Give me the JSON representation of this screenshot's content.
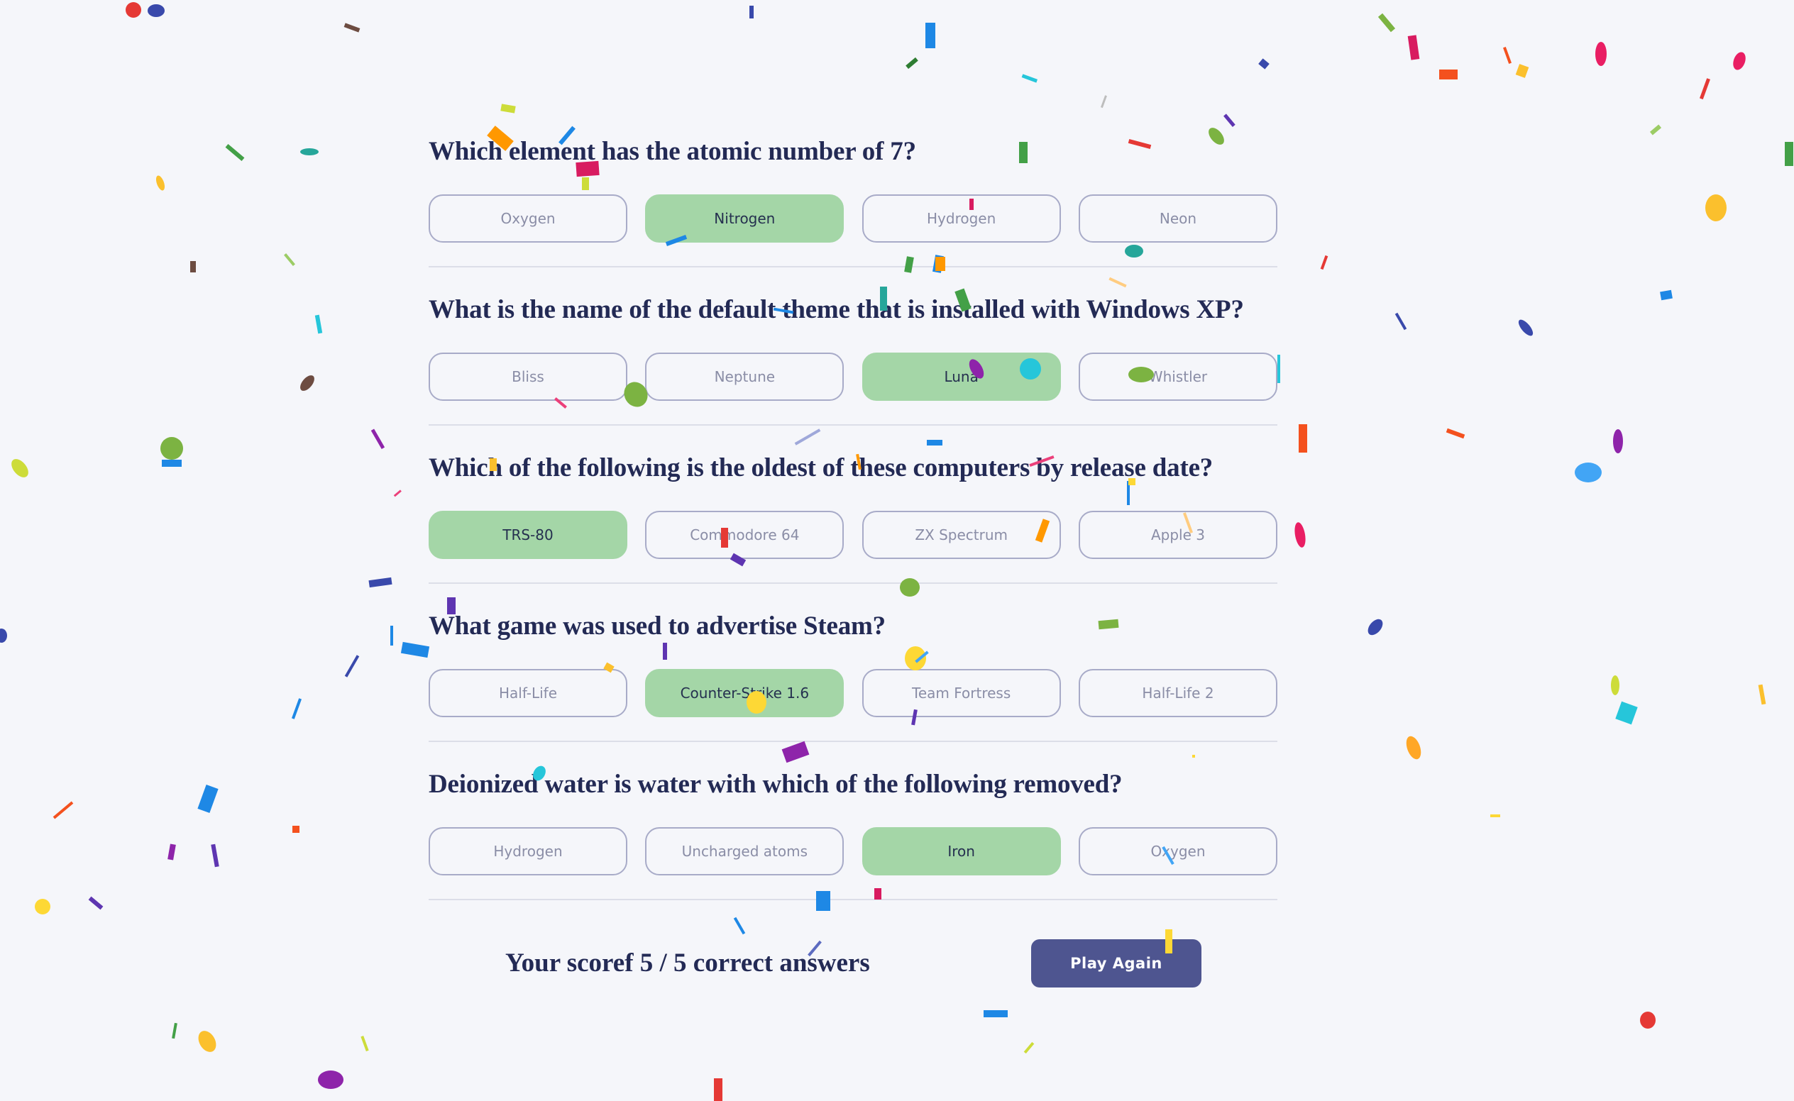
{
  "quiz": {
    "questions": [
      {
        "text": "Which element has the atomic number of 7?",
        "answers": [
          "Oxygen",
          "Nitrogen",
          "Hydrogen",
          "Neon"
        ],
        "correct_index": 1
      },
      {
        "text": "What is the name of the default theme that is installed with Windows XP?",
        "answers": [
          "Bliss",
          "Neptune",
          "Luna",
          "Whistler"
        ],
        "correct_index": 2
      },
      {
        "text": "Which of the following is the oldest of these computers by release date?",
        "answers": [
          "TRS-80",
          "Commodore 64",
          "ZX Spectrum",
          "Apple 3"
        ],
        "correct_index": 0
      },
      {
        "text": "What game was used to advertise Steam?",
        "answers": [
          "Half-Life",
          "Counter-Strike 1.6",
          "Team Fortress",
          "Half-Life 2"
        ],
        "correct_index": 1
      },
      {
        "text": "Deionized water is water with which of the following removed?",
        "answers": [
          "Hydrogen",
          "Uncharged atoms",
          "Iron",
          "Oxygen"
        ],
        "correct_index": 2
      }
    ]
  },
  "result": {
    "score_text": "Your scoref 5 / 5 correct answers",
    "play_again_label": "Play Again"
  },
  "colors": {
    "background": "#f5f6fa",
    "heading": "#232a55",
    "correct_answer": "#a4d6a7",
    "answer_border": "#a8abc8",
    "button": "#4e5590"
  }
}
